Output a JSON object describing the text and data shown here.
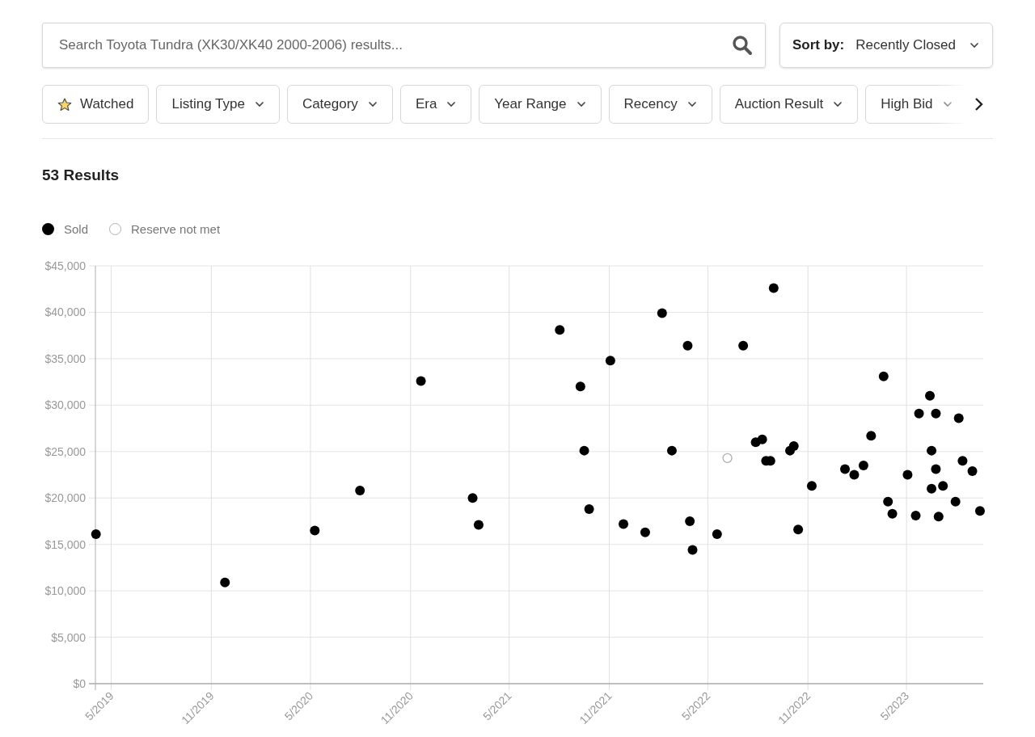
{
  "search": {
    "placeholder": "Search Toyota Tundra (XK30/XK40 2000-2006) results..."
  },
  "sort": {
    "label": "Sort by:",
    "value": "Recently Closed"
  },
  "filters": [
    {
      "kind": "toggle",
      "label": "Watched"
    },
    {
      "kind": "dropdown",
      "label": "Listing Type"
    },
    {
      "kind": "dropdown",
      "label": "Category"
    },
    {
      "kind": "dropdown",
      "label": "Era"
    },
    {
      "kind": "dropdown",
      "label": "Year Range"
    },
    {
      "kind": "dropdown",
      "label": "Recency"
    },
    {
      "kind": "dropdown",
      "label": "Auction Result"
    },
    {
      "kind": "dropdown",
      "label": "High Bid"
    }
  ],
  "results_count": "53 Results",
  "chart": {
    "point_styles": [
      {
        "filled": true
      },
      {
        "filled": false
      }
    ],
    "chart_data": {
      "type": "scatter",
      "grid": true,
      "xlim": [
        "2019-04-02",
        "2023-09-19"
      ],
      "ylim": [
        0,
        45000
      ],
      "xticks": [
        {
          "value": "2019-05-01",
          "label": "5/2019"
        },
        {
          "value": "2019-11-01",
          "label": "11/2019"
        },
        {
          "value": "2020-05-01",
          "label": "5/2020"
        },
        {
          "value": "2020-11-01",
          "label": "11/2020"
        },
        {
          "value": "2021-05-01",
          "label": "5/2021"
        },
        {
          "value": "2021-11-01",
          "label": "11/2021"
        },
        {
          "value": "2022-05-01",
          "label": "5/2022"
        },
        {
          "value": "2022-11-01",
          "label": "11/2022"
        },
        {
          "value": "2023-05-01",
          "label": "5/2023"
        }
      ],
      "yticks": [
        {
          "value": 0,
          "label": "$0"
        },
        {
          "value": 5000,
          "label": "$5,000"
        },
        {
          "value": 10000,
          "label": "$10,000"
        },
        {
          "value": 15000,
          "label": "$15,000"
        },
        {
          "value": 20000,
          "label": "$20,000"
        },
        {
          "value": 25000,
          "label": "$25,000"
        },
        {
          "value": 30000,
          "label": "$30,000"
        },
        {
          "value": 35000,
          "label": "$35,000"
        },
        {
          "value": 40000,
          "label": "$40,000"
        },
        {
          "value": 45000,
          "label": "$45,000"
        }
      ],
      "series": [
        {
          "name": "Sold",
          "color": "#000000",
          "marker": "circle",
          "x": [
            "2019-04-03",
            "2019-11-26",
            "2020-05-09",
            "2020-07-31",
            "2020-11-20",
            "2021-02-23",
            "2021-03-06",
            "2021-08-02",
            "2021-09-09",
            "2021-09-16",
            "2021-09-25",
            "2021-11-03",
            "2021-11-27",
            "2022-01-06",
            "2022-02-06",
            "2022-02-24",
            "2022-03-25",
            "2022-03-29",
            "2022-04-03",
            "2022-05-18",
            "2022-07-05",
            "2022-07-28",
            "2022-08-09",
            "2022-08-16",
            "2022-08-24",
            "2022-08-30",
            "2022-09-29",
            "2022-10-06",
            "2022-10-14",
            "2022-11-08",
            "2023-01-08",
            "2023-01-25",
            "2023-02-11",
            "2023-02-25",
            "2023-03-20",
            "2023-03-28",
            "2023-04-05",
            "2023-05-03",
            "2023-05-18",
            "2023-05-24",
            "2023-06-13",
            "2023-06-16",
            "2023-06-16",
            "2023-06-24",
            "2023-06-24",
            "2023-06-29",
            "2023-07-07",
            "2023-07-30",
            "2023-08-05",
            "2023-08-12",
            "2023-08-30",
            "2023-09-13"
          ],
          "values": [
            16100,
            10900,
            16500,
            20800,
            32600,
            20000,
            17100,
            38100,
            32000,
            25100,
            18800,
            34800,
            17200,
            16300,
            39900,
            25100,
            36400,
            17500,
            14400,
            16100,
            36400,
            26000,
            26300,
            24000,
            24000,
            42600,
            25100,
            25600,
            16600,
            21300,
            23100,
            22500,
            23500,
            26700,
            33100,
            19600,
            18300,
            22500,
            18100,
            29100,
            31000,
            25100,
            21000,
            29100,
            23100,
            18000,
            21300,
            19600,
            28600,
            24000,
            22900,
            18600
          ]
        },
        {
          "name": "Reserve not met",
          "color": "#b0b0b0",
          "marker": "circle",
          "x": [
            "2022-06-06"
          ],
          "values": [
            24300
          ]
        }
      ]
    }
  }
}
